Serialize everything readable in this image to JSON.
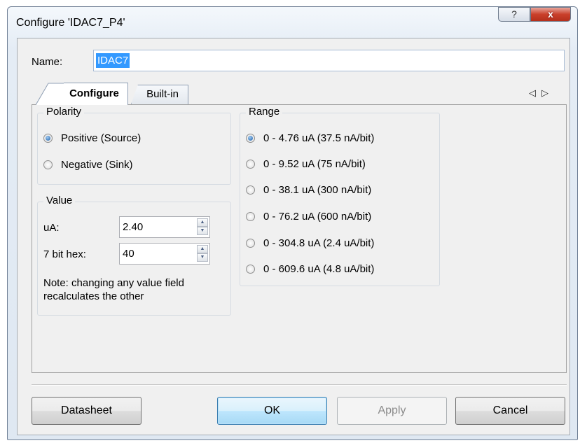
{
  "window": {
    "title": "Configure 'IDAC7_P4'",
    "help_label": "?",
    "close_label": "x"
  },
  "name": {
    "label": "Name:",
    "value": "IDAC7"
  },
  "tabs": [
    {
      "label": "Configure",
      "active": true
    },
    {
      "label": "Built-in",
      "active": false
    }
  ],
  "tab_scroll": {
    "left": "◁",
    "right": "▷"
  },
  "polarity": {
    "legend": "Polarity",
    "options": [
      {
        "label": "Positive (Source)",
        "selected": true
      },
      {
        "label": "Negative (Sink)",
        "selected": false
      }
    ]
  },
  "value": {
    "legend": "Value",
    "ua_label": "uA:",
    "ua_value": "2.40",
    "hex_label": "7 bit hex:",
    "hex_value": "40",
    "note": "Note: changing any value field recalculates the other"
  },
  "range": {
    "legend": "Range",
    "options": [
      {
        "label": "0 - 4.76 uA (37.5 nA/bit)",
        "selected": true
      },
      {
        "label": "0 - 9.52 uA (75 nA/bit)",
        "selected": false
      },
      {
        "label": "0 - 38.1 uA (300 nA/bit)",
        "selected": false
      },
      {
        "label": "0 - 76.2 uA (600 nA/bit)",
        "selected": false
      },
      {
        "label": "0 - 304.8 uA (2.4 uA/bit)",
        "selected": false
      },
      {
        "label": "0 - 609.6 uA (4.8 uA/bit)",
        "selected": false
      }
    ]
  },
  "buttons": {
    "datasheet": "Datasheet",
    "ok": "OK",
    "apply": "Apply",
    "cancel": "Cancel"
  }
}
